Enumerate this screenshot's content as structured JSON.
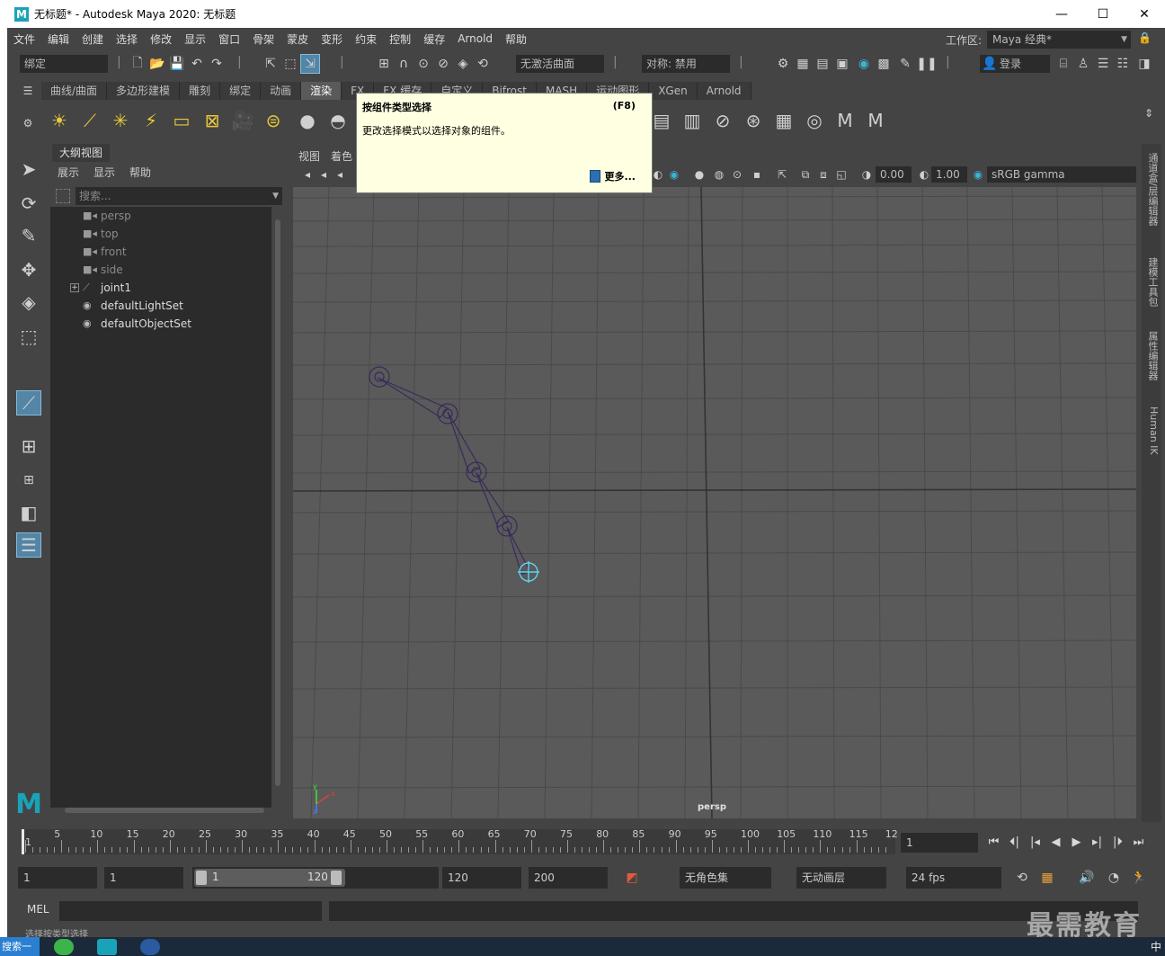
{
  "window": {
    "title": "无标题* - Autodesk Maya 2020: 无标题",
    "app_icon": "M",
    "minimize": "—",
    "maximize": "☐",
    "close": "✕"
  },
  "menubar": {
    "items": [
      "文件",
      "编辑",
      "创建",
      "选择",
      "修改",
      "显示",
      "窗口",
      "骨架",
      "蒙皮",
      "变形",
      "约束",
      "控制",
      "缓存",
      "Arnold",
      "帮助"
    ],
    "workspace_label": "工作区:",
    "workspace_value": "Maya 经典*"
  },
  "statusline": {
    "mode_select": "绑定",
    "live_surface": "无激活曲面",
    "symmetry": "对称: 禁用",
    "login": "登录"
  },
  "shelf": {
    "tabs": [
      "曲线/曲面",
      "多边形建模",
      "雕刻",
      "绑定",
      "动画",
      "渲染",
      "FX",
      "FX 缓存",
      "自定义",
      "Bifrost",
      "MASH",
      "运动图形",
      "XGen",
      "Arnold"
    ],
    "active_tab": "渲染"
  },
  "tooltip": {
    "title": "按组件类型选择",
    "shortcut": "(F8)",
    "description": "更改选择模式以选择对象的组件。",
    "more": "更多..."
  },
  "outliner": {
    "tab": "大纲视图",
    "menus": [
      "展示",
      "显示",
      "帮助"
    ],
    "search_placeholder": "搜索...",
    "items": [
      {
        "label": "persp",
        "icon": "camera-icon",
        "dim": true
      },
      {
        "label": "top",
        "icon": "camera-icon",
        "dim": true
      },
      {
        "label": "front",
        "icon": "camera-icon",
        "dim": true
      },
      {
        "label": "side",
        "icon": "camera-icon",
        "dim": true
      },
      {
        "label": "joint1",
        "icon": "joint-icon",
        "dim": false,
        "expandable": true
      },
      {
        "label": "defaultLightSet",
        "icon": "set-icon",
        "dim": false
      },
      {
        "label": "defaultObjectSet",
        "icon": "set-icon",
        "dim": false
      }
    ]
  },
  "viewport": {
    "menus": [
      "视图",
      "着色"
    ],
    "exposure": "0.00",
    "gamma": "1.00",
    "color_space": "sRGB gamma",
    "camera_label": "persp",
    "axis_x": "x",
    "axis_y": "y",
    "axis_z": "z"
  },
  "right_tabs": [
    "通道盒/层编辑器",
    "建模工具包",
    "属性编辑器",
    "Human IK"
  ],
  "timeslider": {
    "labels": [
      "5",
      "10",
      "15",
      "20",
      "25",
      "30",
      "35",
      "40",
      "45",
      "50",
      "55",
      "60",
      "65",
      "70",
      "75",
      "80",
      "85",
      "90",
      "95",
      "100",
      "105",
      "110",
      "115",
      "12"
    ],
    "first_label": "1",
    "current_frame": "1"
  },
  "range": {
    "start": "1",
    "playback_start": "1",
    "range_start": "1",
    "range_end": "120",
    "playback_end": "120",
    "end": "200",
    "character_set": "无角色集",
    "anim_layer": "无动画层",
    "fps": "24 fps"
  },
  "cmdline": {
    "label": "MEL"
  },
  "helpline": "选择按类型选择",
  "watermark": "最需教育",
  "taskbar": {
    "start": "搜索一下",
    "tray": "中"
  },
  "colors": {
    "bg": "#444444",
    "viewport": "#5a5a5a",
    "field": "#2b2b2b",
    "accent": "#5285a6",
    "tooltip": "#ffffe1"
  }
}
